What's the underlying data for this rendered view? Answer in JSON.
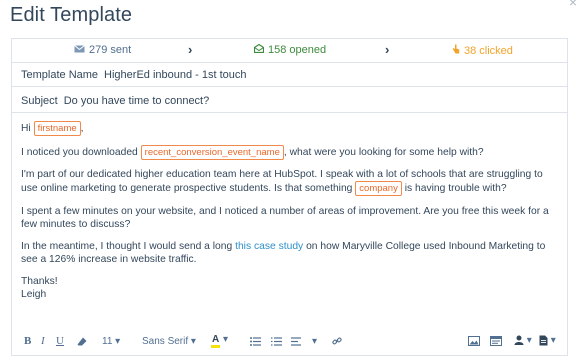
{
  "page": {
    "title": "Edit Template",
    "close_icon": "×"
  },
  "stats": {
    "sent": "279 sent",
    "opened": "158 opened",
    "clicked": "38 clicked",
    "chevron": "›"
  },
  "fields": {
    "template_name_label": "Template Name",
    "template_name_value": "HigherEd inbound - 1st touch",
    "subject_label": "Subject",
    "subject_value": "Do you have time to connect?"
  },
  "body": {
    "greeting_prefix": "Hi ",
    "token_firstname": "firstname",
    "greeting_suffix": ",",
    "p1_prefix": "I noticed you downloaded ",
    "token_conversion": "recent_conversion_event_name",
    "p1_suffix": ", what were you looking for some help with?",
    "p2_prefix": "I'm part of our dedicated higher education team here at HubSpot. I speak with a lot of schools that are struggling to use online marketing to generate prospective students. Is that something ",
    "token_company": "company",
    "p2_suffix": " is having trouble with?",
    "p3": "I spent a few minutes on your website, and I noticed a number of areas of improvement. Are you free this week for a few minutes to discuss?",
    "p4_prefix": "In the meantime, I thought I would send a long ",
    "p4_link": "this case study",
    "p4_suffix": " on how Maryville College used Inbound Marketing to see a 126% increase in website traffic.",
    "signoff": "Thanks!",
    "signature": "Leigh"
  },
  "toolbar": {
    "bold": "B",
    "italic": "I",
    "underline": "U",
    "font_size": "11",
    "font_family": "Sans Serif",
    "font_color_letter": "A",
    "dropdown_caret": "▾",
    "highlight_color": "#f5e40a"
  },
  "colors": {
    "opened": "#3d8b3d",
    "clicked": "#f2a32a",
    "token_border": "#f08a4b",
    "link": "#2e8fc9"
  }
}
